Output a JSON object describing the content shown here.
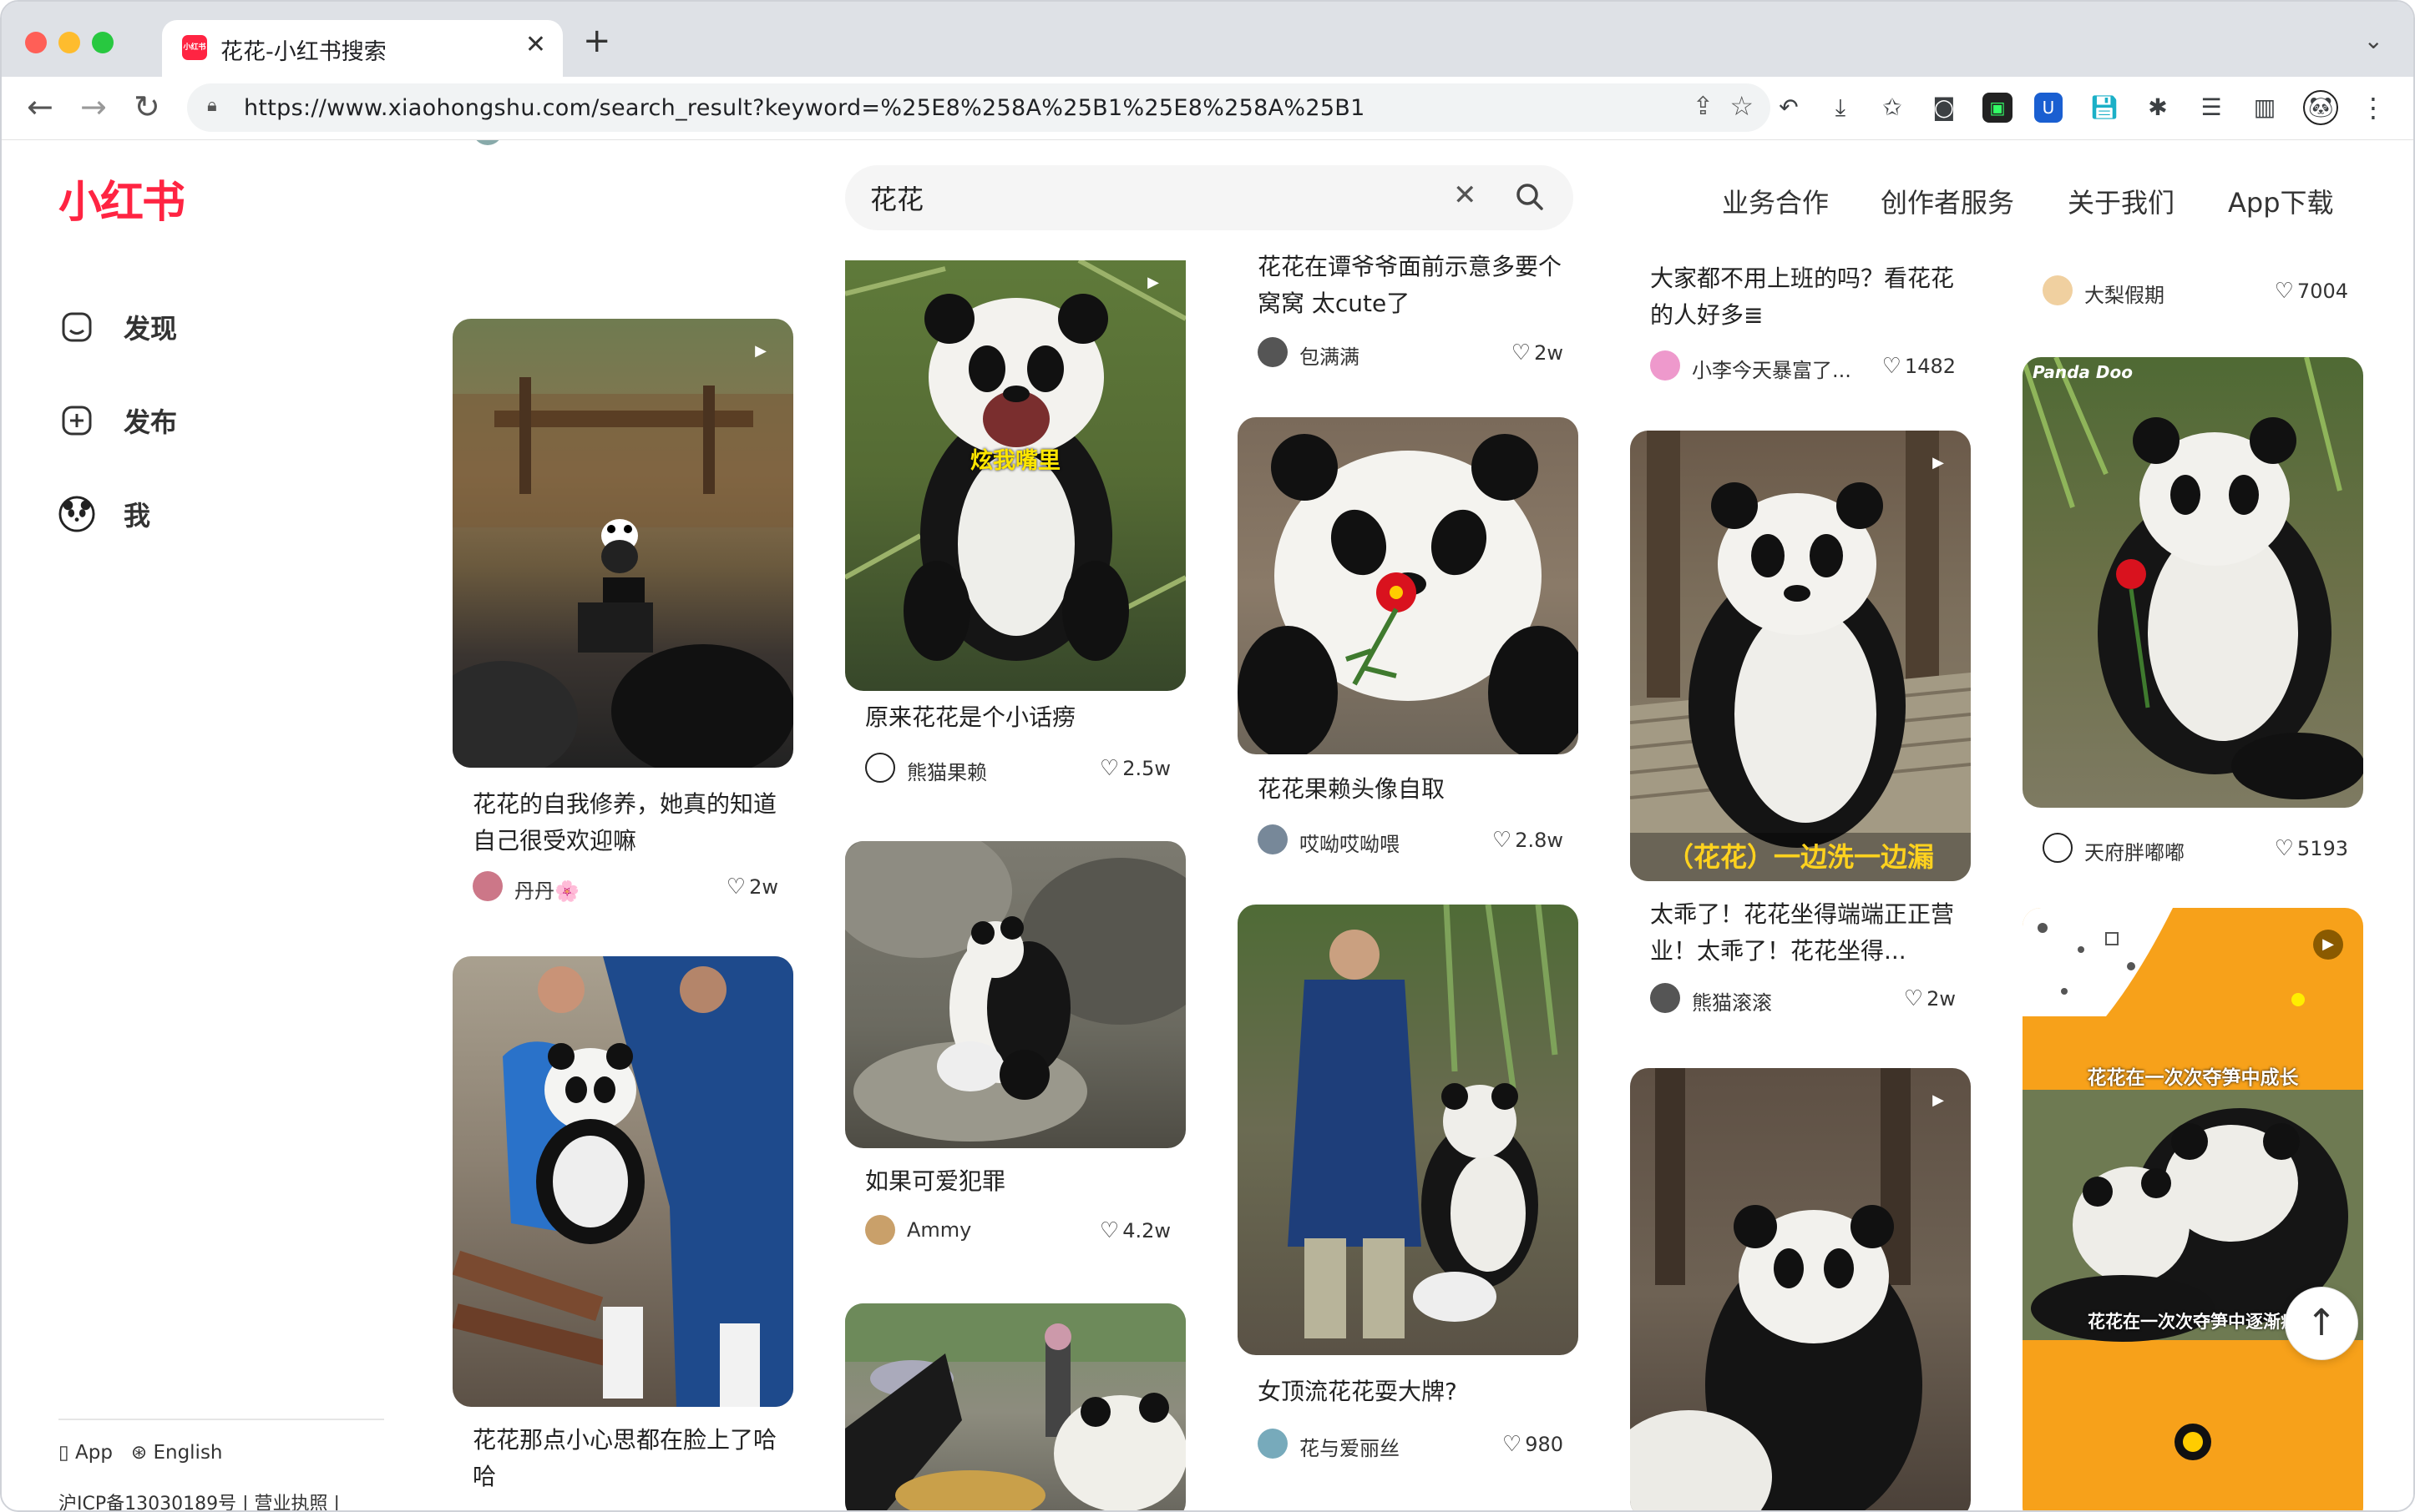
{
  "browser": {
    "tab_title": "花花-小红书搜索",
    "url": "https://www.xiaohongshu.com/search_result?keyword=%25E8%258A%25B1%25E8%258A%25B1",
    "new_tab": "+",
    "close": "✕"
  },
  "site": {
    "logo": "小红书",
    "search": {
      "value": "花花"
    },
    "nav": [
      "业务合作",
      "创作者服务",
      "关于我们",
      "App下载"
    ],
    "sidebar": [
      {
        "label": "发现",
        "icon": "home-icon"
      },
      {
        "label": "发布",
        "icon": "plus-icon"
      },
      {
        "label": "我",
        "icon": "avatar-icon"
      }
    ],
    "footer": {
      "app": "App",
      "english": "English",
      "icp": "沪ICP备13030189号 | 营业执照 |"
    }
  },
  "feed": {
    "col1": [
      {
        "title": "花花的自我修养，她真的知道自己很受欢迎嘛",
        "author": "丹丹🌸",
        "likes": "2w"
      },
      {
        "title": "花花那点小心思都在脸上了哈哈",
        "author": "",
        "likes": ""
      }
    ],
    "col2": [
      {
        "title": "原来花花是个小话痨",
        "author": "熊猫果赖",
        "likes": "2.5w",
        "caption": "炫我嘴里"
      },
      {
        "title": "如果可爱犯罪",
        "author": "Ammy",
        "likes": "4.2w"
      },
      {
        "title": "",
        "author": "",
        "likes": ""
      }
    ],
    "col3": [
      {
        "title": "花花在谭爷爷面前示意多要个窝窝 太cute了",
        "author": "包满满",
        "likes": "2w"
      },
      {
        "title": "花花果赖头像自取",
        "author": "哎呦哎呦喂",
        "likes": "2.8w"
      },
      {
        "title": "女顶流花花耍大牌?",
        "author": "花与爱丽丝",
        "likes": "980"
      }
    ],
    "col4": [
      {
        "title": "大家都不用上班的吗？看花花的人好多≣",
        "author": "小李今天暴富了...",
        "likes": "1482"
      },
      {
        "title": "太乖了！花花坐得端端正正营业！太乖了！花花坐得...",
        "author": "熊猫滚滚",
        "likes": "2w",
        "caption": "（花花）一边洗一边漏"
      },
      {
        "title": "",
        "author": "",
        "likes": ""
      }
    ],
    "col5": [
      {
        "title": "",
        "author": "大梨假期",
        "likes": "7004"
      },
      {
        "title": "",
        "author": "天府胖嘟嘟",
        "likes": "5193",
        "watermark": "Panda Doo"
      },
      {
        "title": "",
        "author": "",
        "likes": "",
        "caption_top": "花花在一次次夺笋中成长",
        "caption_bottom": "花花在一次次夺笋中逐渐疯"
      }
    ]
  },
  "colors": {
    "brand": "#ff2442",
    "orange": "#f7a11a"
  }
}
